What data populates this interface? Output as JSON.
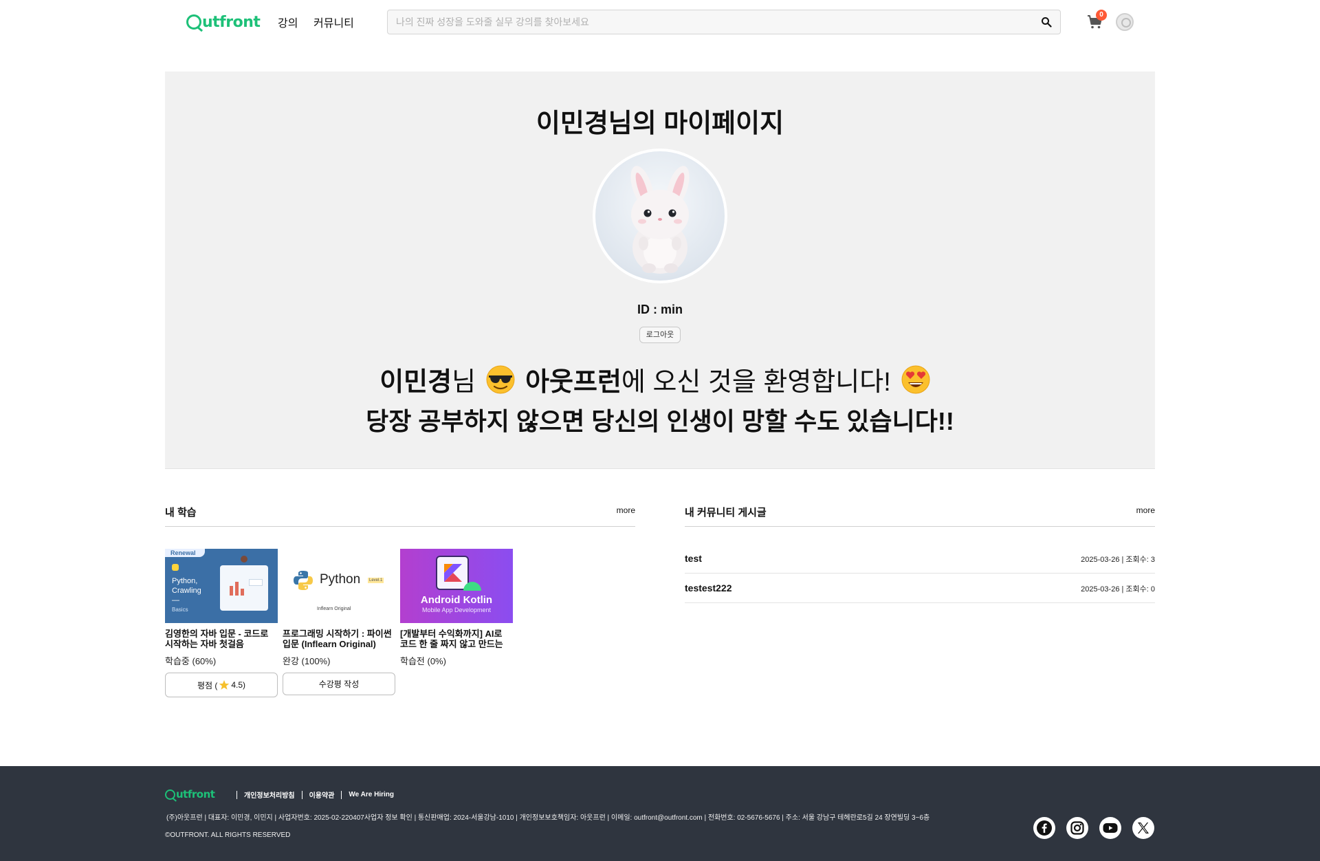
{
  "header": {
    "logo_text": "utfront",
    "nav": [
      "강의",
      "커뮤니티"
    ],
    "search_placeholder": "나의 진짜 성장을 도와줄 실무 강의를 찾아보세요",
    "cart_count": "0"
  },
  "hero": {
    "title": "이민경님의 마이페이지",
    "id_label": "ID : min",
    "logout_label": "로그아웃",
    "welcome": {
      "name": "이민경",
      "honorific": "님",
      "brand": "아웃프런",
      "rest": "에 오신 것을 환영합니다!"
    },
    "motto": "당장 공부하지 않으면 당신의 인생이 망할 수도 있습니다!!"
  },
  "learning": {
    "title": "내 학습",
    "more": "more",
    "courses": [
      {
        "title": "김영한의 자바 입문 - 코드로 시작하는 자바 첫걸음",
        "progress": "학습중 (60%)",
        "thumb_badge": "Renewal",
        "thumb_lines": [
          "Python,",
          "Crawling",
          "—",
          "Basics"
        ],
        "button_prefix": "평점 (",
        "button_value": "4.5)"
      },
      {
        "title": "프로그래밍 시작하기 : 파이썬 입문 (Inflearn Original)",
        "progress": "완강 (100%)",
        "thumb_word": "Python",
        "thumb_level": "Level.1",
        "thumb_sub": "Inflearn Original",
        "button": "수강평 작성"
      },
      {
        "title": "[개발부터 수익화까지] AI로 코드 한 줄 짜지 않고 만드는 안드로이드 앱",
        "progress": "학습전 (0%)",
        "thumb_title": "Android Kotlin",
        "thumb_sub": "Mobile App Development"
      }
    ]
  },
  "community": {
    "title": "내 커뮤니티 게시글",
    "more": "more",
    "posts": [
      {
        "title": "test",
        "meta": "2025-03-26 | 조회수: 3"
      },
      {
        "title": "testest222",
        "meta": "2025-03-26 | 조회수: 0"
      }
    ]
  },
  "footer": {
    "logo_text": "utfront",
    "links": [
      "개인정보처리방침",
      "이용약관",
      "We Are Hiring"
    ],
    "info": "(주)아웃프런 |  대표자: 이민경, 이민지 |  사업자번호: 2025-02-220407사업자 정보 확인 | 통신판매업: 2024-서울강남-1010 |  개인정보보호책임자: 아웃프런 |  이메일: outfront@outfront.com | 전화번호: 02-5676-5676 |  주소: 서울 강남구 테헤란로5길 24 장연빌딩 3~6층",
    "copyright": "©OUTFRONT. ALL RIGHTS RESERVED"
  },
  "colors": {
    "brand": "#1dc078",
    "footer_bg": "#2f353f",
    "hero_bg": "#f1f1f1",
    "badge": "#ff5a36"
  }
}
